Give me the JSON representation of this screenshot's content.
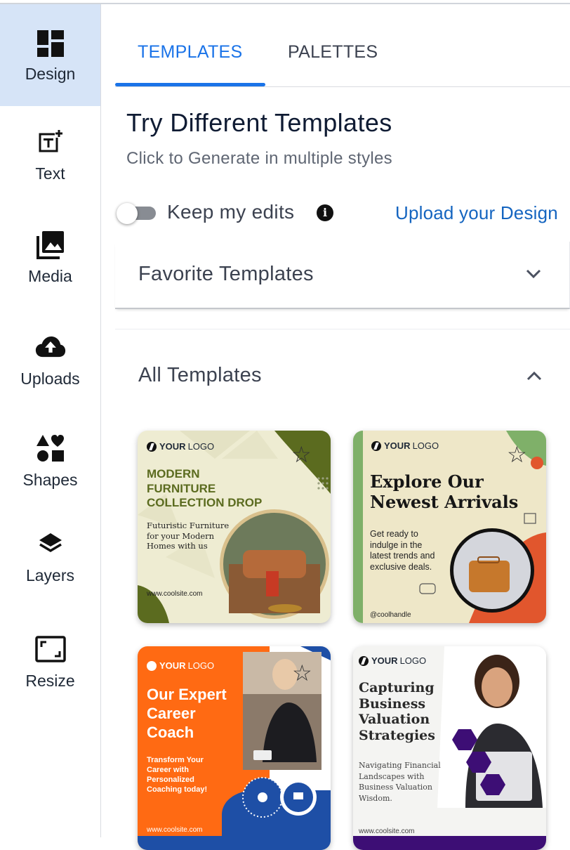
{
  "sidebar": {
    "items": [
      {
        "label": "Design",
        "icon": "design-grid-icon"
      },
      {
        "label": "Text",
        "icon": "text-add-icon"
      },
      {
        "label": "Media",
        "icon": "media-gallery-icon"
      },
      {
        "label": "Uploads",
        "icon": "cloud-upload-icon"
      },
      {
        "label": "Shapes",
        "icon": "shapes-icon"
      },
      {
        "label": "Layers",
        "icon": "layers-icon"
      },
      {
        "label": "Resize",
        "icon": "resize-icon"
      }
    ],
    "active": "Design"
  },
  "tabs": [
    {
      "label": "TEMPLATES",
      "active": true
    },
    {
      "label": "PALETTES",
      "active": false
    }
  ],
  "header": {
    "title": "Try Different Templates",
    "subtitle": "Click to Generate in multiple styles"
  },
  "controls": {
    "keep_edits_label": "Keep my edits",
    "keep_edits_on": false,
    "info_glyph": "i",
    "upload_link": "Upload your Design"
  },
  "sections": {
    "favorites": {
      "title": "Favorite Templates",
      "expanded": false
    },
    "all": {
      "title": "All Templates",
      "expanded": true
    }
  },
  "templates": [
    {
      "logo_your": "YOUR",
      "logo_word": "LOGO",
      "headline": [
        "MODERN",
        "FURNITURE",
        "COLLECTION DROP"
      ],
      "body": [
        "Futuristic Furniture",
        "for your Modern",
        "Homes with us"
      ],
      "footer": "www.coolsite.com"
    },
    {
      "logo_your": "YOUR",
      "logo_word": "LOGO",
      "headline": [
        "Explore Our",
        "Newest Arrivals"
      ],
      "body": [
        "Get ready to",
        "indulge in the",
        "latest trends and",
        "exclusive deals."
      ],
      "footer": "@coolhandle"
    },
    {
      "logo_your": "YOUR",
      "logo_word": "LOGO",
      "headline": [
        "Our Expert",
        "Career",
        "Coach"
      ],
      "body": [
        "Transform Your",
        "Career with",
        "Personalized",
        "Coaching today!"
      ],
      "footer": "www.coolsite.com"
    },
    {
      "logo_your": "YOUR",
      "logo_word": "LOGO",
      "headline": [
        "Capturing",
        "Business",
        "Valuation",
        "Strategies"
      ],
      "body": [
        "Navigating Financial",
        "Landscapes with",
        "Business Valuation",
        "Wisdom."
      ],
      "footer": "www.coolsite.com"
    }
  ],
  "colors": {
    "accent": "#1a73e8",
    "sidebar_active_bg": "#d6e4f7",
    "link": "#1565c0",
    "template1_green": "#5b6b1f",
    "template2_bar": "#7fb069",
    "template3_orange": "#ff6a13",
    "template3_blue": "#1e4fa6",
    "template4_purple": "#3d0e75"
  }
}
